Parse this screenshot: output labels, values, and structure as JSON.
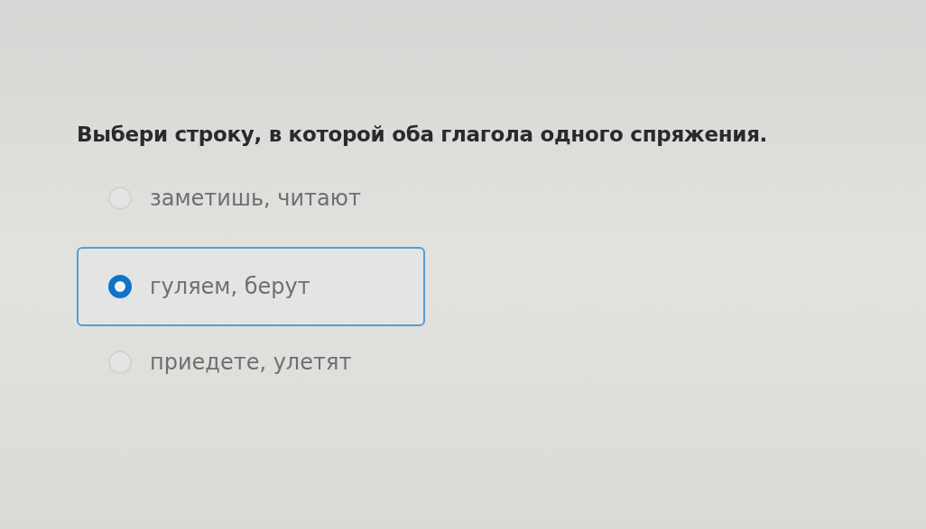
{
  "question": "Выбери строку, в которой оба глагола одного спряжения.",
  "options": [
    {
      "label": "заметишь, читают",
      "selected": false
    },
    {
      "label": "гуляем, берут",
      "selected": true
    },
    {
      "label": "приедете, улетят",
      "selected": false
    }
  ]
}
